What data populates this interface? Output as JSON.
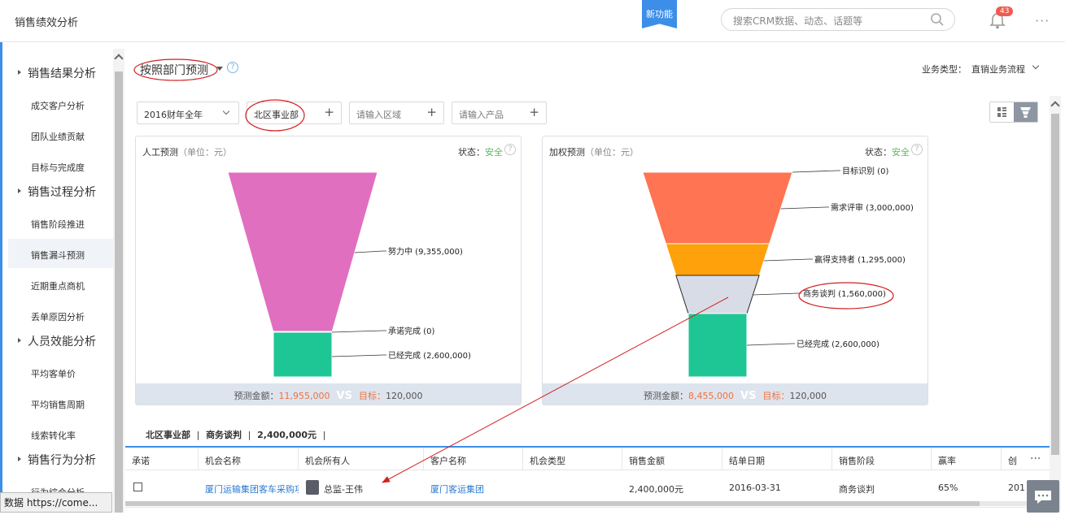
{
  "header": {
    "app_title": "销售绩效分析",
    "new_feature": "新功能",
    "search_placeholder": "搜索CRM数据、动态、话题等",
    "notification_count": "43",
    "more": "···"
  },
  "sidebar": {
    "groups": [
      {
        "label": "销售结果分析",
        "items": [
          "成交客户分析",
          "团队业绩贡献",
          "目标与完成度"
        ]
      },
      {
        "label": "销售过程分析",
        "items": [
          "销售阶段推进",
          "销售漏斗预测",
          "近期重点商机",
          "丢单原因分析"
        ]
      },
      {
        "label": "人员效能分析",
        "items": [
          "平均客单价",
          "平均销售周期",
          "线索转化率"
        ]
      },
      {
        "label": "销售行为分析",
        "items": [
          "行为综合分析"
        ]
      }
    ],
    "active_item": "销售漏斗预测"
  },
  "toolbar": {
    "forecast_mode": "按照部门预测",
    "help": "?",
    "business_type_label": "业务类型：",
    "business_type_value": "直销业务流程"
  },
  "filters": {
    "period": "2016财年全年",
    "department": "北区事业部",
    "region_placeholder": "请输入区域",
    "product_placeholder": "请输入产品",
    "add": "+"
  },
  "manual_panel": {
    "title": "人工预测",
    "unit": "（单位：元）",
    "status_label": "状态：",
    "status_value": "安全",
    "footer_label": "预测金额：",
    "footer_amount": "11,955,000",
    "vs": "VS",
    "target_label": "目标：",
    "target_value": "120,000"
  },
  "weighted_panel": {
    "title": "加权预测",
    "unit": "（单位：元）",
    "status_label": "状态：",
    "status_value": "安全",
    "footer_label": "预测金额：",
    "footer_amount": "8,455,000",
    "vs": "VS",
    "target_label": "目标：",
    "target_value": "120,000"
  },
  "chart_data": [
    {
      "type": "funnel",
      "title": "人工预测",
      "stages": [
        {
          "name": "努力中",
          "value": 9355000,
          "label": "努力中 (9,355,000)",
          "color": "#e06fc0"
        },
        {
          "name": "承诺完成",
          "value": 0,
          "label": "承诺完成 (0)",
          "color": "#e06fc0"
        },
        {
          "name": "已经完成",
          "value": 2600000,
          "label": "已经完成 (2,600,000)",
          "color": "#1ec695"
        }
      ]
    },
    {
      "type": "funnel",
      "title": "加权预测",
      "stages": [
        {
          "name": "目标识别",
          "value": 0,
          "label": "目标识别 (0)",
          "color": "#ff7452"
        },
        {
          "name": "需求评审",
          "value": 3000000,
          "label": "需求评审 (3,000,000)",
          "color": "#ff7452"
        },
        {
          "name": "赢得支持者",
          "value": 1295000,
          "label": "赢得支持者 (1,295,000)",
          "color": "#ffa10a"
        },
        {
          "name": "商务谈判",
          "value": 1560000,
          "label": "商务谈判 (1,560,000)",
          "color": "#d8dce6"
        },
        {
          "name": "已经完成",
          "value": 2600000,
          "label": "已经完成 (2,600,000)",
          "color": "#1ec695"
        }
      ]
    }
  ],
  "breadcrumb": {
    "dept": "北区事业部",
    "stage": "商务谈判",
    "amount": "2,400,000元",
    "sep": "|"
  },
  "table": {
    "columns": [
      "承诺",
      "机会名称",
      "机会所有人",
      "客户名称",
      "机会类型",
      "销售金额",
      "结单日期",
      "销售阶段",
      "赢率",
      "创"
    ],
    "row": {
      "name": "厦门运输集团客车采购项",
      "owner": "总监-王伟",
      "customer": "厦门客运集团",
      "type": "",
      "amount": "2,400,000元",
      "close_date": "2016-03-31",
      "stage": "商务谈判",
      "win_rate": "65%",
      "created": "201"
    },
    "more": "···"
  },
  "status_bar": "数据 https://come..."
}
